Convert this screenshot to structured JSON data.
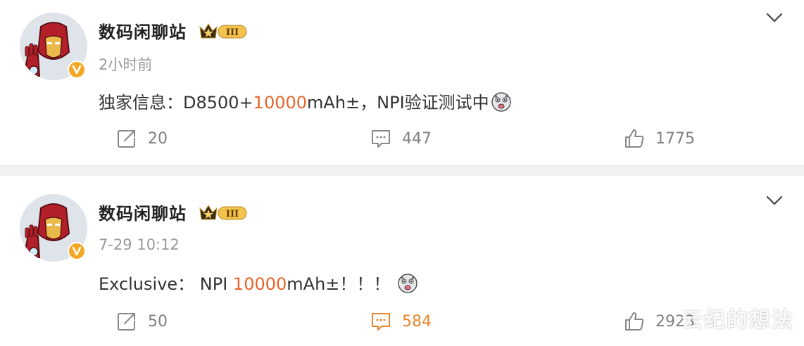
{
  "posts": [
    {
      "username": "数码闲聊站",
      "level": "III",
      "time": "2小时前",
      "content_pre": "独家信息：D8500+",
      "content_highlight": "10000",
      "content_post": "mAh±，NPI验证测试中",
      "repost_count": "20",
      "comment_count": "447",
      "like_count": "1775",
      "comment_active": false
    },
    {
      "username": "数码闲聊站",
      "level": "III",
      "time": "7-29 10:12",
      "content_pre": "Exclusive： NPI ",
      "content_highlight": "10000",
      "content_post": "mAh±！！！",
      "repost_count": "50",
      "comment_count": "584",
      "like_count": "2923",
      "comment_active": true
    }
  ],
  "watermark": "云纪的想法",
  "colors": {
    "highlight": "#e8642c",
    "active_action": "#e8842c",
    "muted": "#999999",
    "divider": "#f0f0f2"
  }
}
